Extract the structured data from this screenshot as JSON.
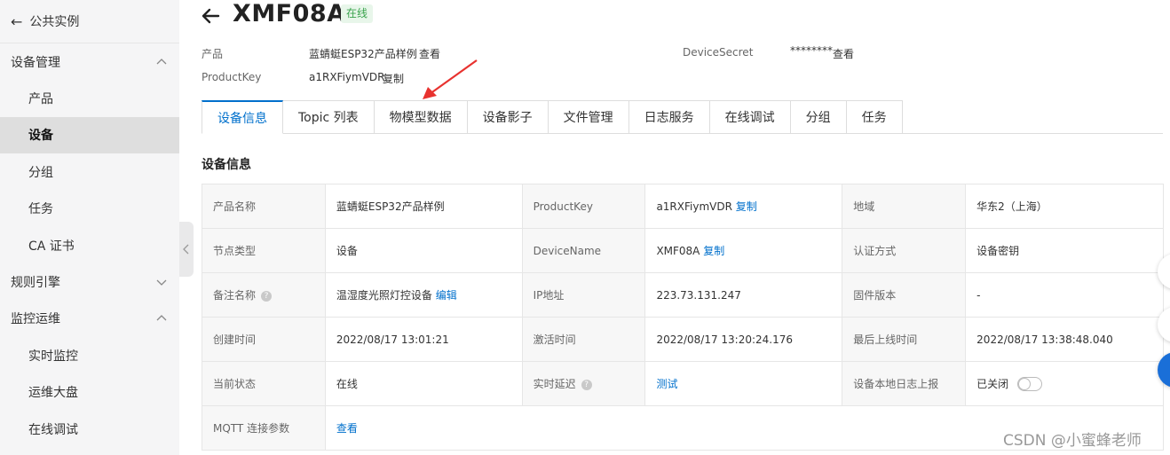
{
  "sidebar": {
    "back_label": "公共实例",
    "groups": [
      {
        "label": "设备管理",
        "expanded": true,
        "items": [
          "产品",
          "设备",
          "分组",
          "任务",
          "CA 证书"
        ]
      },
      {
        "label": "规则引擎",
        "expanded": false,
        "items": []
      },
      {
        "label": "监控运维",
        "expanded": true,
        "items": [
          "实时监控",
          "运维大盘",
          "在线调试"
        ]
      }
    ],
    "active_item": "设备"
  },
  "header": {
    "title": "XMF08A",
    "status_badge": "在线",
    "status_color": "#3aa34d"
  },
  "meta": {
    "product_label": "产品",
    "product_value": "蓝蜻蜓ESP32产品样例",
    "product_link": "查看",
    "productkey_label": "ProductKey",
    "productkey_value": "a1RXFiymVDR",
    "productkey_link": "复制",
    "secret_label": "DeviceSecret",
    "secret_value": "********",
    "secret_link": "查看"
  },
  "tabs": [
    "设备信息",
    "Topic 列表",
    "物模型数据",
    "设备影子",
    "文件管理",
    "日志服务",
    "在线调试",
    "分组",
    "任务"
  ],
  "active_tab": "设备信息",
  "section_title": "设备信息",
  "info": {
    "r1": {
      "k1": "产品名称",
      "v1": "蓝蜻蜓ESP32产品样例",
      "k2": "ProductKey",
      "v2": "a1RXFiymVDR",
      "v2_link": "复制",
      "k3": "地域",
      "v3": "华东2（上海）"
    },
    "r2": {
      "k1": "节点类型",
      "v1": "设备",
      "k2": "DeviceName",
      "v2": "XMF08A",
      "v2_link": "复制",
      "k3": "认证方式",
      "v3": "设备密钥"
    },
    "r3": {
      "k1": "备注名称",
      "v1": "温湿度光照灯控设备",
      "v1_link": "编辑",
      "k2": "IP地址",
      "v2": "223.73.131.247",
      "k3": "固件版本",
      "v3": "-"
    },
    "r4": {
      "k1": "创建时间",
      "v1": "2022/08/17 13:01:21",
      "k2": "激活时间",
      "v2": "2022/08/17 13:20:24.176",
      "k3": "最后上线时间",
      "v3": "2022/08/17 13:38:48.040"
    },
    "r5": {
      "k1": "当前状态",
      "v1": "在线",
      "k2": "实时延迟",
      "v2_link": "测试",
      "k3": "设备本地日志上报",
      "v3": "已关闭"
    },
    "r6": {
      "k1": "MQTT 连接参数",
      "v1_link": "查看"
    }
  },
  "help_glyph": "?",
  "watermark": "CSDN @小蜜蜂老师",
  "accent_color": "#0070cc",
  "annotation_arrow_color": "#e8322f"
}
